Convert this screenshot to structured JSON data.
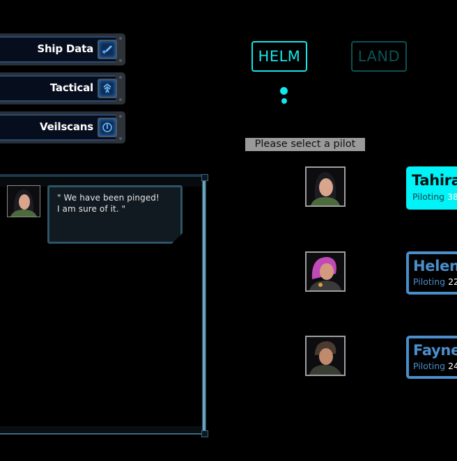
{
  "menu": {
    "items": [
      {
        "label": "Ship Data",
        "icon": "rocket-icon"
      },
      {
        "label": "Tactical",
        "icon": "tactical-icon"
      },
      {
        "label": "Veilscans",
        "icon": "scan-icon"
      }
    ]
  },
  "modes": {
    "helm_label": "HELM",
    "land_label": "LAND",
    "active": "HELM"
  },
  "prompt": "Please select a pilot",
  "pilots": [
    {
      "name": "Tahira",
      "stat_label": "Piloting",
      "stat_value": "38",
      "selected": true
    },
    {
      "name": "Helen",
      "stat_label": "Piloting",
      "stat_value": "22",
      "selected": false
    },
    {
      "name": "Fayne",
      "stat_label": "Piloting",
      "stat_value": "24",
      "selected": false
    }
  ],
  "comms": {
    "speaker": "Tahira",
    "lines": [
      "\" We have been pinged!",
      "I am sure of it. \""
    ]
  },
  "colors": {
    "accent_cyan": "#00f3f7",
    "inactive_teal": "#0c5256",
    "pilot_blue": "#4a8fcc",
    "panel_border": "#2d5467"
  }
}
